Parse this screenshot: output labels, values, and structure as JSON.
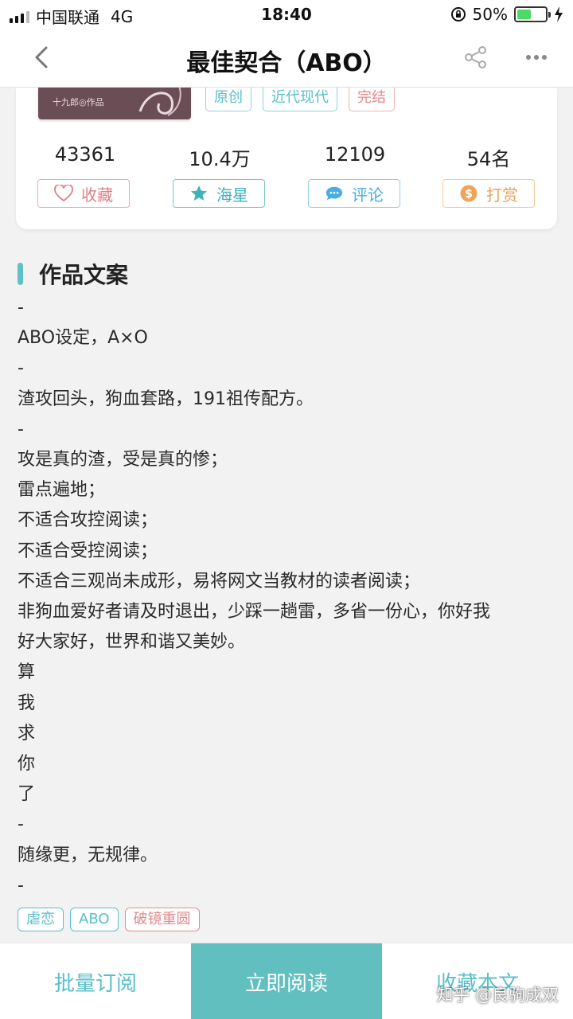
{
  "status_bar": {
    "carrier": "中国联通",
    "network": "4G",
    "time": "18:40",
    "battery_percent": "50%",
    "battery_level": 0.5
  },
  "nav": {
    "title": "最佳契合（ABO）"
  },
  "book": {
    "cover_text": "十九郎◎作品",
    "tags": [
      "原创",
      "近代现代",
      "完结"
    ],
    "stats": {
      "collects": "43361",
      "stars": "10.4万",
      "comments": "12109",
      "reward_rank": "54名"
    },
    "actions": {
      "collect": "收藏",
      "star": "海星",
      "comment": "评论",
      "reward": "打赏"
    }
  },
  "section": {
    "title": "作品文案"
  },
  "description": [
    "-",
    "ABO设定，A×O",
    "-",
    "渣攻回头，狗血套路，191祖传配方。",
    "-",
    "攻是真的渣，受是真的惨；",
    "雷点遍地；",
    "不适合攻控阅读；",
    "不适合受控阅读；",
    "不适合三观尚未成形，易将网文当教材的读者阅读；",
    "非狗血爱好者请及时退出，少踩一趟雷，多省一份心，你好我",
    "好大家好，世界和谐又美妙。",
    "算",
    "我",
    "求",
    "你",
    "了",
    "-",
    "随缘更，无规律。",
    "-"
  ],
  "bottom_tags": [
    "虐恋",
    "ABO",
    "破镜重圆"
  ],
  "bottom_bar": {
    "batch": "批量订阅",
    "read": "立即阅读",
    "favorite": "收藏本文"
  },
  "watermark": "知乎 @良驹成双",
  "colors": {
    "teal": "#5fc0c6",
    "pink": "#e07f86",
    "blue": "#46aee2",
    "orange": "#e8a257"
  }
}
